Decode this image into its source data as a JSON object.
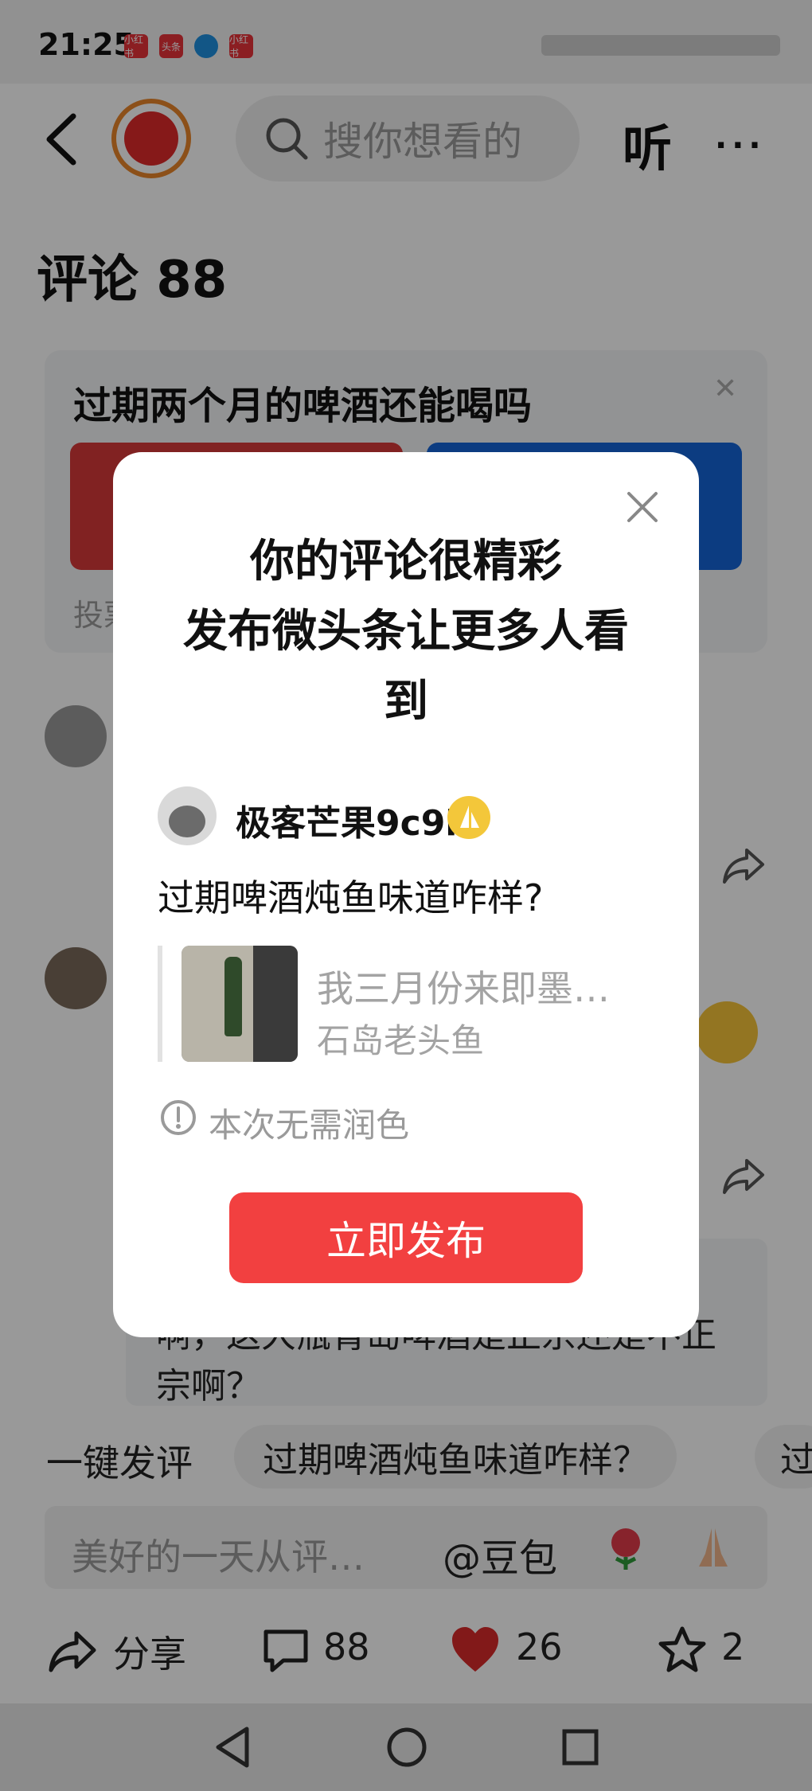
{
  "status_bar": {
    "time": "21:25",
    "notifications": [
      "小红书",
      "头条",
      "",
      "小红书"
    ]
  },
  "header": {
    "search_placeholder": "搜你想看的",
    "listen_label": "听",
    "more_label": "···"
  },
  "comments": {
    "title": "评论 88"
  },
  "poll": {
    "question": "过期两个月的啤酒还能喝吗",
    "footer_text": "投票"
  },
  "background_comment": {
    "quote_text": "啊，这大瓶青岛啤酒是正宗还是不正宗啊？"
  },
  "quick_reply": {
    "label": "一键发评",
    "chips": [
      "过期啤酒炖鱼味道咋样？",
      "过"
    ]
  },
  "input_bar": {
    "placeholder": "美好的一天从评…",
    "mention": "@豆包"
  },
  "actions": {
    "share_label": "分享",
    "comment_count": "88",
    "like_count": "26",
    "favorite_count": "2"
  },
  "modal": {
    "title_line1": "你的评论很精彩",
    "title_line2": "发布微头条让更多人看",
    "title_line3": "到",
    "user_name": "极客芒果9c9i",
    "comment_text": "过期啤酒炖鱼味道咋样?",
    "ref_text": "我三月份来即墨…",
    "ref_author": "石岛老头鱼",
    "info_text": "本次无需润色",
    "publish_button": "立即发布"
  },
  "colors": {
    "accent_red": "#f24040",
    "like_red": "#d92a2a",
    "poll_red": "#d73a3a",
    "poll_blue": "#1565d8",
    "badge_gold": "#f3c73a"
  }
}
